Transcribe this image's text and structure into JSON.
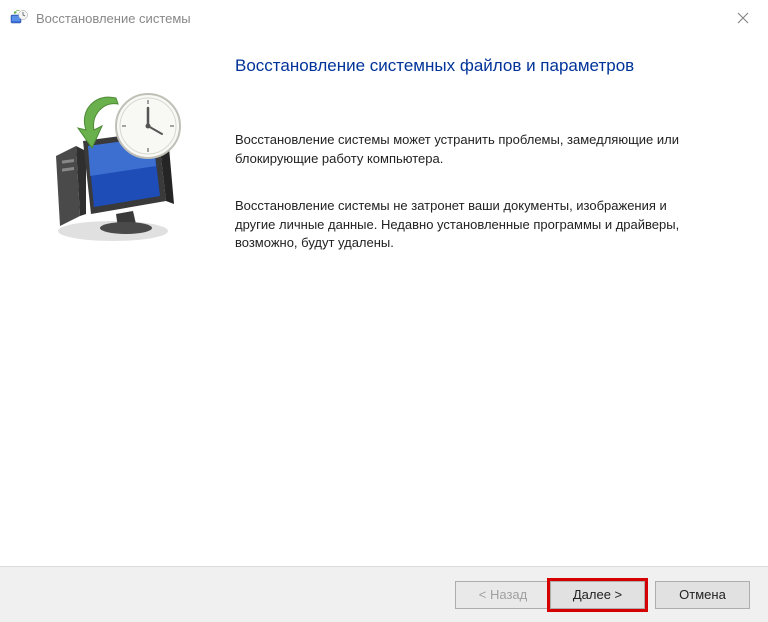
{
  "titlebar": {
    "title": "Восстановление системы"
  },
  "main": {
    "heading": "Восстановление системных файлов и параметров",
    "paragraph1": "Восстановление системы может устранить проблемы, замедляющие или блокирующие работу компьютера.",
    "paragraph2": "Восстановление системы не затронет ваши документы, изображения и другие личные данные. Недавно установленные программы и драйверы, возможно, будут удалены."
  },
  "buttons": {
    "back": "< Назад",
    "next": "Далее >",
    "cancel": "Отмена"
  }
}
